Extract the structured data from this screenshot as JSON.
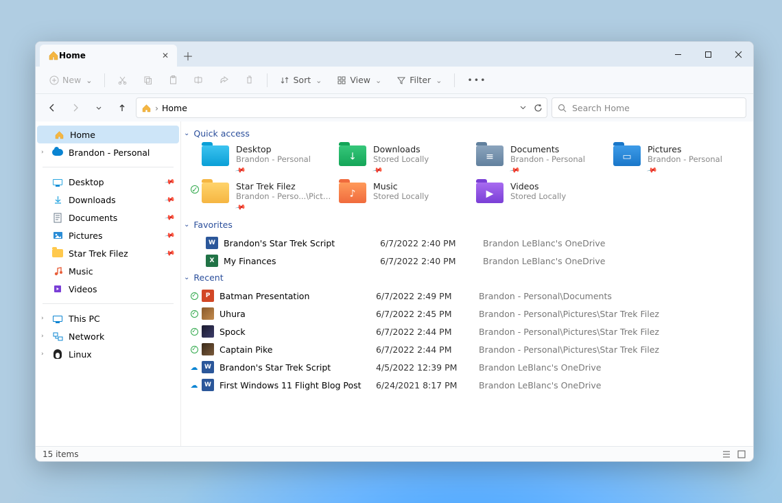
{
  "window": {
    "tab_title": "Home"
  },
  "toolbar": {
    "new": "New",
    "sort": "Sort",
    "view": "View",
    "filter": "Filter"
  },
  "breadcrumb": {
    "current": "Home"
  },
  "search": {
    "placeholder": "Search Home"
  },
  "sidebar": {
    "home": "Home",
    "onedrive": "Brandon - Personal",
    "items": [
      {
        "label": "Desktop",
        "pinned": true
      },
      {
        "label": "Downloads",
        "pinned": true
      },
      {
        "label": "Documents",
        "pinned": true
      },
      {
        "label": "Pictures",
        "pinned": true
      },
      {
        "label": "Star Trek Filez",
        "pinned": true
      },
      {
        "label": "Music",
        "pinned": false
      },
      {
        "label": "Videos",
        "pinned": false
      }
    ],
    "this_pc": "This PC",
    "network": "Network",
    "linux": "Linux"
  },
  "sections": {
    "quick": "Quick access",
    "favorites": "Favorites",
    "recent": "Recent"
  },
  "quick_access": [
    {
      "name": "Desktop",
      "sub": "Brandon - Personal",
      "pinned": true,
      "color": "big-folder"
    },
    {
      "name": "Downloads",
      "sub": "Stored Locally",
      "pinned": true,
      "color": "big-folder bf-green",
      "overlay": "↓"
    },
    {
      "name": "Documents",
      "sub": "Brandon - Personal",
      "pinned": true,
      "color": "big-folder bf-slate",
      "overlay": "≡"
    },
    {
      "name": "Pictures",
      "sub": "Brandon - Personal",
      "pinned": true,
      "color": "big-folder bf-blue",
      "overlay": "▭"
    },
    {
      "name": "Star Trek Filez",
      "sub": "Brandon - Perso...\\Pictures",
      "pinned": true,
      "color": "big-folder bf-yellow",
      "sync": true
    },
    {
      "name": "Music",
      "sub": "Stored Locally",
      "pinned": false,
      "color": "big-folder bf-orange",
      "overlay": "♪"
    },
    {
      "name": "Videos",
      "sub": "Stored Locally",
      "pinned": false,
      "color": "big-folder bf-purple",
      "overlay": "▶"
    }
  ],
  "favorites": [
    {
      "name": "Brandon's Star Trek Script",
      "date": "6/7/2022 2:40 PM",
      "loc": "Brandon LeBlanc's OneDrive",
      "ft": "ft-word",
      "ft_label": "W"
    },
    {
      "name": "My Finances",
      "date": "6/7/2022 2:40 PM",
      "loc": "Brandon LeBlanc's OneDrive",
      "ft": "ft-excel",
      "ft_label": "X"
    }
  ],
  "recent": [
    {
      "name": "Batman Presentation",
      "date": "6/7/2022 2:49 PM",
      "loc": "Brandon - Personal\\Documents",
      "ft": "ft-ppt",
      "ft_label": "P",
      "sync": true
    },
    {
      "name": "Uhura",
      "date": "6/7/2022 2:45 PM",
      "loc": "Brandon - Personal\\Pictures\\Star Trek Filez",
      "ft": "ft-img",
      "sync": true
    },
    {
      "name": "Spock",
      "date": "6/7/2022 2:44 PM",
      "loc": "Brandon - Personal\\Pictures\\Star Trek Filez",
      "ft": "ft-img2",
      "sync": true
    },
    {
      "name": "Captain Pike",
      "date": "6/7/2022 2:44 PM",
      "loc": "Brandon - Personal\\Pictures\\Star Trek Filez",
      "ft": "ft-img3",
      "sync": true
    },
    {
      "name": "Brandon's Star Trek Script",
      "date": "4/5/2022 12:39 PM",
      "loc": "Brandon LeBlanc's OneDrive",
      "ft": "ft-word",
      "ft_label": "W",
      "cloud": true
    },
    {
      "name": "First Windows 11 Flight Blog Post",
      "date": "6/24/2021 8:17 PM",
      "loc": "Brandon LeBlanc's OneDrive",
      "ft": "ft-word",
      "ft_label": "W",
      "cloud": true
    }
  ],
  "footer": {
    "status": "15 items"
  }
}
